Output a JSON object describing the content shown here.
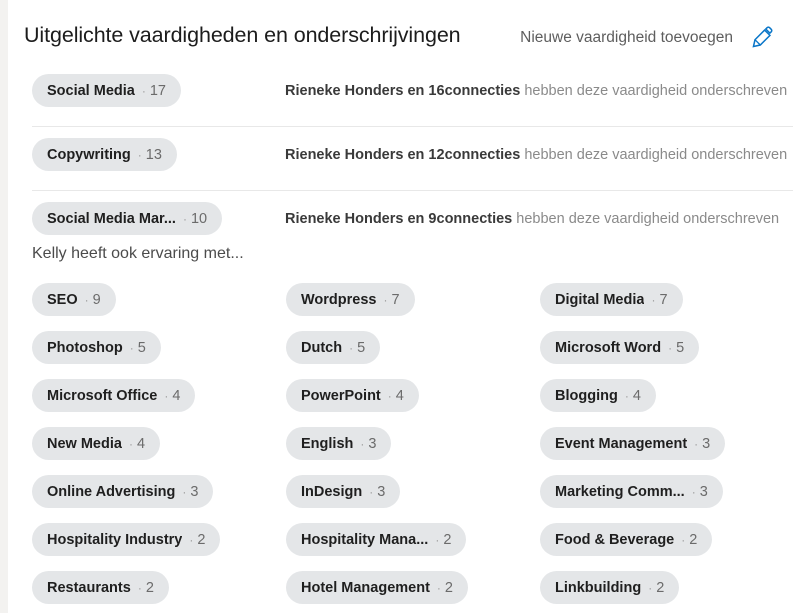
{
  "header": {
    "title": "Uitgelichte vaardigheden en onderschrijvingen",
    "action_label": "Nieuwe vaardigheid toevoegen",
    "edit_icon": "pencil-icon",
    "accent_color": "#0a66c2"
  },
  "featured": {
    "rows": [
      {
        "skill": "Social Media",
        "count": "17",
        "separator": "·",
        "endorsers_bold": "Rieneke Honders en 16connecties",
        "endorsers_rest": " hebben deze vaardigheid onderschreven"
      },
      {
        "skill": "Copywriting",
        "count": "13",
        "separator": "·",
        "endorsers_bold": "Rieneke Honders en 12connecties",
        "endorsers_rest": " hebben deze vaardigheid onderschreven"
      },
      {
        "skill": "Social Media Mar...",
        "count": "10",
        "separator": "·",
        "endorsers_bold": "Rieneke Honders en 9connecties",
        "endorsers_rest": " hebben deze vaardigheid onderschreven"
      }
    ]
  },
  "also": {
    "heading": "Kelly heeft ook ervaring met...",
    "separator": "·",
    "rows": [
      [
        {
          "label": "SEO",
          "count": "9"
        },
        {
          "label": "Wordpress",
          "count": "7"
        },
        {
          "label": "Digital Media",
          "count": "7"
        }
      ],
      [
        {
          "label": "Photoshop",
          "count": "5"
        },
        {
          "label": "Dutch",
          "count": "5"
        },
        {
          "label": "Microsoft Word",
          "count": "5"
        }
      ],
      [
        {
          "label": "Microsoft Office",
          "count": "4"
        },
        {
          "label": "PowerPoint",
          "count": "4"
        },
        {
          "label": "Blogging",
          "count": "4"
        }
      ],
      [
        {
          "label": "New Media",
          "count": "4"
        },
        {
          "label": "English",
          "count": "3"
        },
        {
          "label": "Event Management",
          "count": "3"
        }
      ],
      [
        {
          "label": "Online Advertising",
          "count": "3"
        },
        {
          "label": "InDesign",
          "count": "3"
        },
        {
          "label": "Marketing Comm...",
          "count": "3"
        }
      ],
      [
        {
          "label": "Hospitality Industry",
          "count": "2"
        },
        {
          "label": "Hospitality Mana...",
          "count": "2"
        },
        {
          "label": "Food & Beverage",
          "count": "2"
        }
      ],
      [
        {
          "label": "Restaurants",
          "count": "2"
        },
        {
          "label": "Hotel Management",
          "count": "2"
        },
        {
          "label": "Linkbuilding",
          "count": "2"
        }
      ]
    ]
  }
}
